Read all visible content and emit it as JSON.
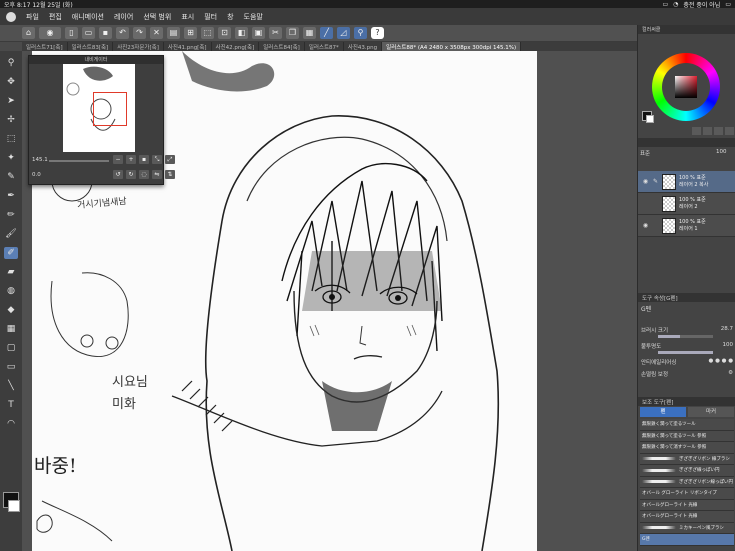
{
  "status": {
    "time_date": "오후 8:17   12월 25일 (화)",
    "right_text": "충전 중이 아님"
  },
  "menu": [
    "파일",
    "편집",
    "애니메이션",
    "레이어",
    "선택 범위",
    "표시",
    "필터",
    "창",
    "도움말"
  ],
  "tabs": [
    {
      "label": "일러스트71[축]",
      "active": false
    },
    {
      "label": "일러스트83[축]",
      "active": false
    },
    {
      "label": "사진23자문가[축]",
      "active": false
    },
    {
      "label": "사진41.png[축]",
      "active": false
    },
    {
      "label": "사진42.png[축]",
      "active": false
    },
    {
      "label": "일러스트84[축]",
      "active": false
    },
    {
      "label": "일러스트87*",
      "active": false
    },
    {
      "label": "사진43.png",
      "active": false
    },
    {
      "label": "일러스트88* (A4 2480 x 3508px 300dpi 145.1%)",
      "active": true
    }
  ],
  "navigator": {
    "title": "내비게이터",
    "zoom": "145.1",
    "angle": "0.0"
  },
  "right_panel": {
    "color_title": "컬러써클",
    "blend_mode": "표준",
    "opacity": "100",
    "layers": [
      {
        "line1": "100 % 표준",
        "line2": "레이어 2 복사",
        "selected": true
      },
      {
        "line1": "100 % 표준",
        "line2": "레이어 2",
        "selected": false
      },
      {
        "line1": "100 % 표준",
        "line2": "레이어 1",
        "selected": false
      }
    ],
    "tool_property_title": "도구 속성[G펜]",
    "tool_name": "G펜",
    "brush_size_label": "브러시 크기",
    "brush_size": "28.7",
    "opacity_label": "불투명도",
    "opacity_value": "100",
    "antialias_label": "안티에일리어싱",
    "stabilize_label": "손떨림 보정",
    "sub_tool_title": "보조 도구[펜]",
    "sub_tabs": [
      {
        "label": "펜",
        "active": true
      },
      {
        "label": "마커",
        "active": false
      }
    ],
    "brushes": [
      {
        "label": "無限鉄く潤って塗るツール",
        "selected": false
      },
      {
        "label": "無限鉄く潤って塗るツール 参照",
        "selected": false
      },
      {
        "label": "無限鉄く潤って消すツール 参照",
        "selected": false
      },
      {
        "label": "ぎざぎざリボン 線ブラシ",
        "selected": false
      },
      {
        "label": "ぎざぎざ線っぽい円",
        "selected": false
      },
      {
        "label": "ぎざぎざリボン線っぽい円",
        "selected": false
      },
      {
        "label": "オバール グローライト リボンタイプ",
        "selected": false
      },
      {
        "label": "オバールグローライト 光線",
        "selected": false
      },
      {
        "label": "オバールグローライト 光線",
        "selected": false
      },
      {
        "label": "ミカキーペン風ブラシ",
        "selected": false
      },
      {
        "label": "G펜",
        "selected": true
      }
    ]
  },
  "sketch_text": {
    "note1": "거시기냄새남",
    "note2": "시요님",
    "note3": "미화",
    "note4": "바중!"
  }
}
